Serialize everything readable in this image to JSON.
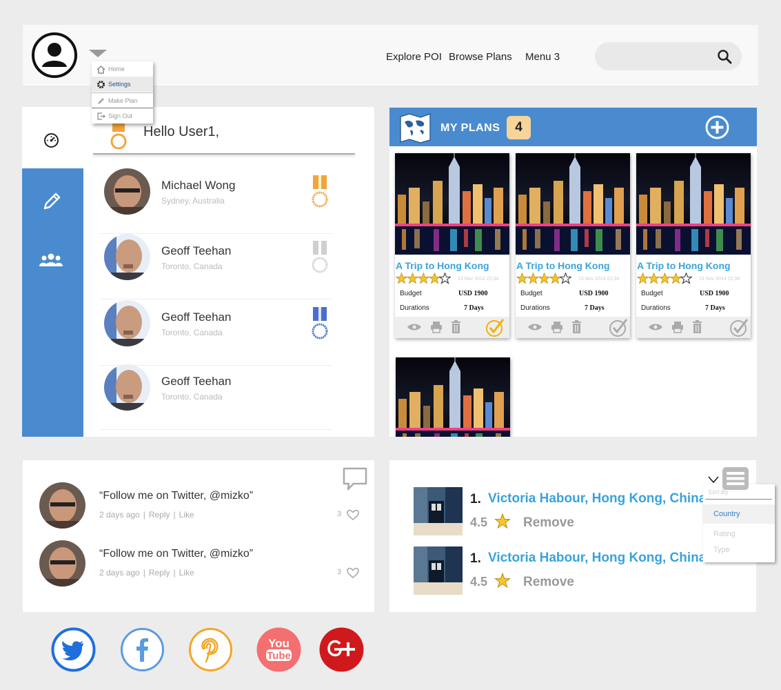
{
  "header": {
    "nav": [
      "Explore POI",
      "Browse Plans",
      "Menu 3"
    ],
    "search_placeholder": ""
  },
  "user_menu": {
    "items": [
      {
        "label": "Home",
        "icon": "home-icon"
      },
      {
        "label": "Settings",
        "icon": "gear-icon",
        "active": true
      },
      {
        "label": "Make Plan",
        "icon": "pencil-icon"
      },
      {
        "label": "Sign Out",
        "icon": "sign-out-icon"
      }
    ]
  },
  "dashboard": {
    "greeting": "Hello User1,",
    "users": [
      {
        "name": "Michael Wong",
        "location": "Sydney, Australia",
        "medal": "gold"
      },
      {
        "name": "Geoff Teehan",
        "location": "Toronto, Canada",
        "medal": "silver"
      },
      {
        "name": "Geoff Teehan",
        "location": "Toronto, Canada",
        "medal": "blue"
      },
      {
        "name": "Geoff Teehan",
        "location": "Toronto, Canada",
        "medal": "none"
      }
    ]
  },
  "plans": {
    "title": "MY PLANS",
    "count": "4",
    "cards": [
      {
        "title": "A Trip to Hong Kong",
        "rating": 4,
        "date": "13 Nov 2014 22:34",
        "budget_label": "Budget",
        "budget": "USD 1900",
        "duration_label": "Durations",
        "duration": "7 Days",
        "done": true
      },
      {
        "title": "A Trip to Hong Kong",
        "rating": 4,
        "date": "13 Nov 2014 22:34",
        "budget_label": "Budget",
        "budget": "USD 1900",
        "duration_label": "Durations",
        "duration": "7 Days",
        "done": false
      },
      {
        "title": "A Trip to Hong Kong",
        "rating": 4,
        "date": "13 Nov 2014 22:34",
        "budget_label": "Budget",
        "budget": "USD 1900",
        "duration_label": "Durations",
        "duration": "7 Days",
        "done": false
      }
    ]
  },
  "comments": [
    {
      "text": "“Follow me on Twitter, @mizko”",
      "time": "2 days ago",
      "reply": "Reply",
      "like": "Like",
      "likes": "3"
    },
    {
      "text": "“Follow me on Twitter, @mizko”",
      "time": "2 days ago",
      "reply": "Reply",
      "like": "Like",
      "likes": "3"
    }
  ],
  "poi": {
    "items": [
      {
        "num": "1.",
        "name": "Victoria Habour, Hong Kong, China",
        "rating": "4.5",
        "remove": "Remove"
      },
      {
        "num": "1.",
        "name": "Victoria Habour, Hong Kong, China",
        "rating": "4.5",
        "remove": "Remove"
      }
    ],
    "sort": {
      "title": "Sort By",
      "options": [
        "Country",
        "Rating",
        "Type"
      ],
      "selected": "Country"
    }
  },
  "social": [
    {
      "name": "twitter",
      "color": "#1e6fdc"
    },
    {
      "name": "facebook",
      "color": "#5a9be0"
    },
    {
      "name": "pinterest",
      "color": "#f5a623"
    },
    {
      "name": "youtube",
      "color": "#f46f6f"
    },
    {
      "name": "google-plus",
      "color": "#d0191c"
    }
  ],
  "colors": {
    "accent": "#4a8bd0",
    "link": "#39a3db",
    "badge": "#f6d49a"
  }
}
